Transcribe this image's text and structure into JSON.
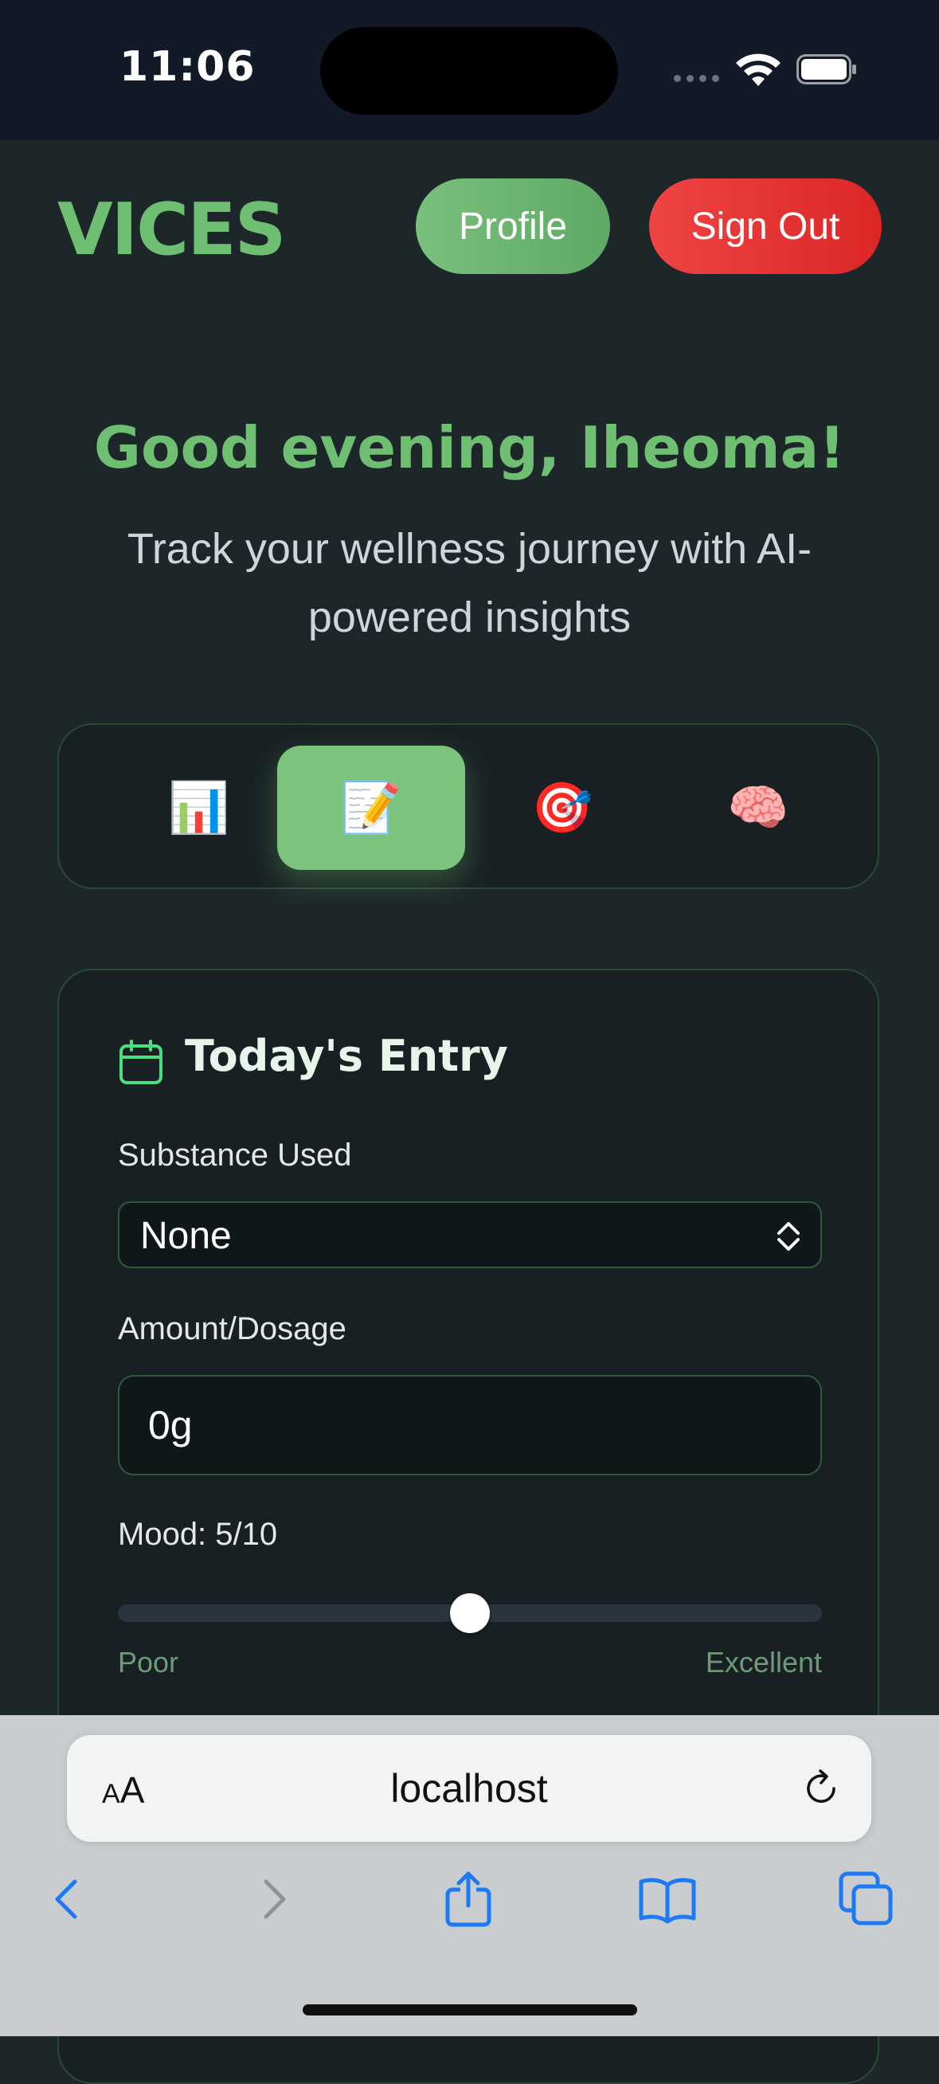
{
  "status_bar": {
    "time": "11:06"
  },
  "header": {
    "logo": "VICES",
    "profile_label": "Profile",
    "signout_label": "Sign Out"
  },
  "hero": {
    "greeting": "Good evening, Iheoma!",
    "subtitle": "Track your wellness journey with AI-powered insights"
  },
  "tabs": [
    {
      "icon": "📊",
      "name": "bar-chart-icon",
      "active": false
    },
    {
      "icon": "📝",
      "name": "memo-icon",
      "active": true
    },
    {
      "icon": "🎯",
      "name": "target-icon",
      "active": false
    },
    {
      "icon": "🧠",
      "name": "brain-icon",
      "active": false
    }
  ],
  "entry": {
    "title": "Today's Entry",
    "substance_label": "Substance Used",
    "substance_value": "None",
    "amount_label": "Amount/Dosage",
    "amount_value": "0g",
    "mood_label": "Mood: 5/10",
    "mood_value": 5,
    "mood_max": 10,
    "mood_min_label": "Poor",
    "mood_max_label": "Excellent"
  },
  "browser": {
    "aa": "AA",
    "url": "localhost"
  },
  "colors": {
    "accent": "#6fbf73",
    "danger": "#ef4444",
    "background": "#1d2629"
  }
}
